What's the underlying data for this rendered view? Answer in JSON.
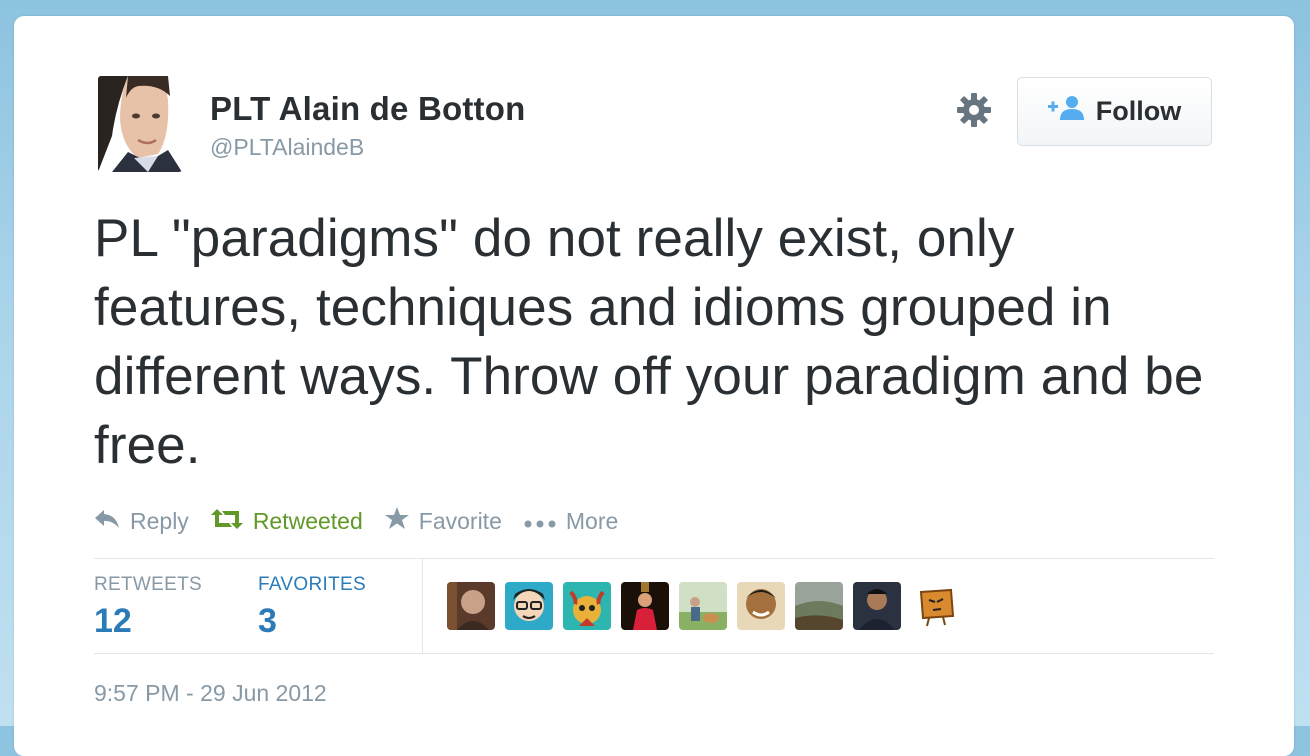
{
  "user": {
    "name": "PLT Alain de Botton",
    "handle": "@PLTAlaindeB"
  },
  "follow_button": {
    "label": "Follow",
    "icon": "add-user-icon"
  },
  "settings": {
    "icon": "gear-icon"
  },
  "tweet": {
    "text": "PL \"paradigms\" do not really exist, only features, techniques and idioms grouped in different ways. Throw off your paradigm and be free."
  },
  "actions": {
    "reply": "Reply",
    "retweeted": "Retweeted",
    "favorite": "Favorite",
    "more": "More"
  },
  "stats": {
    "retweets_label": "RETWEETS",
    "retweets_count": "12",
    "favorites_label": "FAVORITES",
    "favorites_count": "3"
  },
  "timestamp": "9:57 PM - 29 Jun 2012",
  "colors": {
    "text": "#292f33",
    "muted": "#8899a6",
    "link_blue": "#2b7bb9",
    "retweet_green": "#609928"
  }
}
